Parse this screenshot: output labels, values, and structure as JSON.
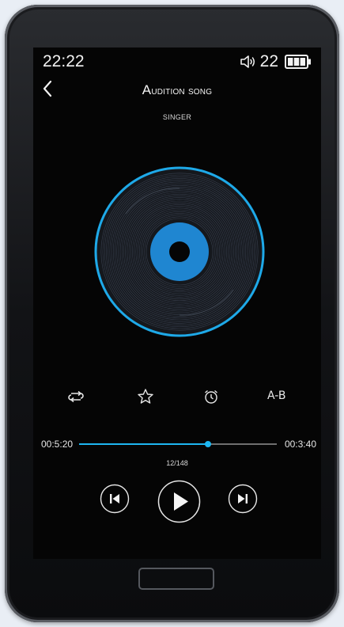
{
  "status": {
    "time": "22:22",
    "volume": "22",
    "battery_level": 1.0
  },
  "header": {
    "title_initial": "A",
    "title_rest": "udition song",
    "singer": "SINGER"
  },
  "controls": {
    "repeat_icon": "repeat-icon",
    "favorite_icon": "star-icon",
    "alarm_icon": "alarm-clock-icon",
    "ab_label": "A-B"
  },
  "playback": {
    "elapsed": "00:5:20",
    "total": "00:3:40",
    "progress_fraction": 0.65,
    "track_counter": "12/148"
  },
  "colors": {
    "accent": "#1eb7f2",
    "disc_center": "#1f86d1",
    "background": "#050505"
  }
}
